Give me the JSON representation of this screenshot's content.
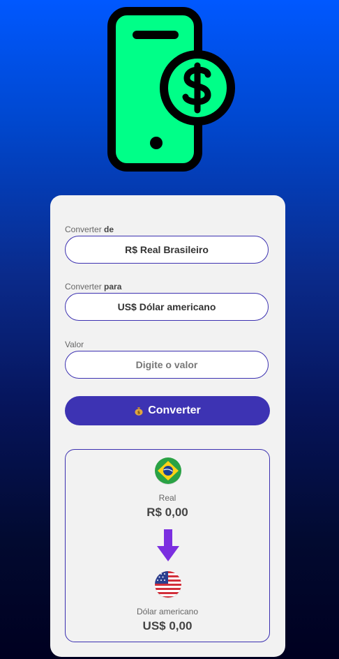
{
  "from": {
    "label_prefix": "Converter ",
    "label_bold": "de",
    "value": "R$ Real Brasileiro"
  },
  "to": {
    "label_prefix": "Converter ",
    "label_bold": "para",
    "value": "US$ Dólar americano"
  },
  "amount": {
    "label": "Valor",
    "placeholder": "Digite o valor"
  },
  "convert_button": {
    "label": "Converter",
    "icon": "money-bag-icon"
  },
  "result": {
    "source": {
      "name": "Real",
      "value": "R$ 0,00",
      "flag": "brazil-flag-icon"
    },
    "target": {
      "name": "Dólar americano",
      "value": "US$ 0,00",
      "flag": "usa-flag-icon"
    }
  },
  "colors": {
    "accent": "#3d33b3",
    "logo_fill": "#00ff88",
    "arrow": "#7b2fe0"
  }
}
